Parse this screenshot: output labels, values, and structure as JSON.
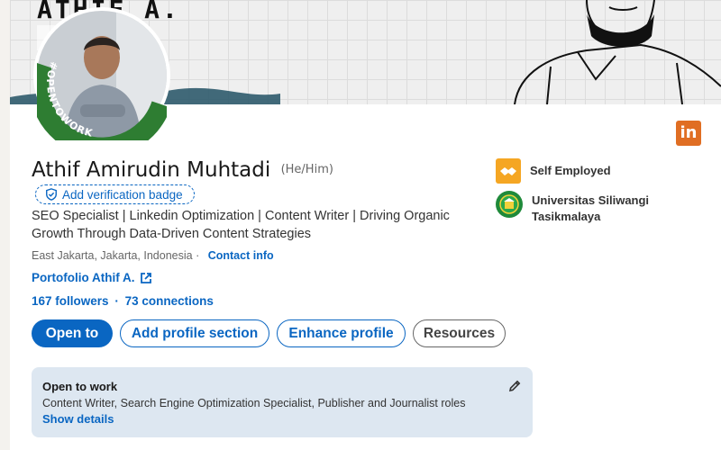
{
  "banner": {
    "title": "ATHIF A."
  },
  "profile": {
    "name": "Athif Amirudin Muhtadi",
    "pronouns": "(He/Him)",
    "verification_label": "Add verification badge",
    "headline": "SEO Specialist | Linkedin Optimization | Content Writer | Driving Organic Growth Through Data-Driven Content Strategies",
    "location": "East Jakarta, Jakarta, Indonesia",
    "separator": "·",
    "contact_label": "Contact info",
    "portfolio_label": "Portofolio Athif A.",
    "followers": "167 followers",
    "connections": "73 connections",
    "open_to_work_ring_text": "#OPENTOWORK"
  },
  "actions": {
    "open_to": "Open to",
    "add_section": "Add profile section",
    "enhance": "Enhance profile",
    "resources": "Resources"
  },
  "open_to_work": {
    "title": "Open to work",
    "roles": "Content Writer, Search Engine Optimization Specialist, Publisher and Journalist roles",
    "show_details": "Show details"
  },
  "experience": [
    {
      "label": "Self Employed",
      "icon": "handshake-icon"
    },
    {
      "label": "Universitas Siliwangi Tasikmalaya",
      "icon": "university-logo"
    }
  ],
  "colors": {
    "accent": "#0a66c2",
    "open_to_work_green": "#2e7d32",
    "self_employed": "#f5a623",
    "university": "#1f8a3a",
    "linkedin_badge": "#e06e23"
  }
}
